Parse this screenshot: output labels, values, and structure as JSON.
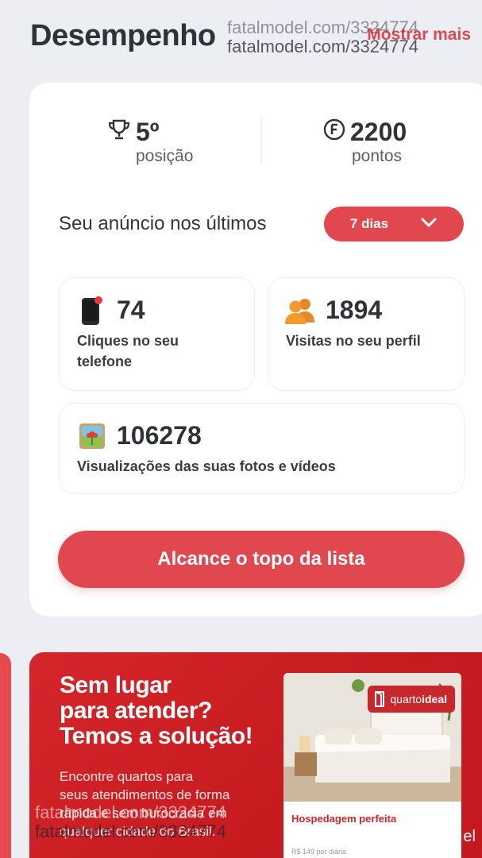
{
  "header": {
    "title": "Desempenho",
    "show_more": "Mostrar mais",
    "watermark": "fatalmodel.com/3324774"
  },
  "ranking": {
    "position_value": "5º",
    "position_label": "posição",
    "points_value": "2200",
    "points_label": "pontos",
    "trophy_icon": "trophy-icon",
    "points_icon": "points-coin-icon"
  },
  "period": {
    "label": "Seu anúncio nos últimos",
    "selected": "7 dias"
  },
  "stats": {
    "phone_clicks": {
      "value": "74",
      "label_line1": "Cliques no seu",
      "label_line2": "telefone",
      "icon": "phone-icon"
    },
    "profile_visits": {
      "value": "1894",
      "label": "Visitas no seu perfil",
      "icon": "people-icon"
    },
    "media_views": {
      "value": "106278",
      "label": "Visualizações das suas fotos e vídeos",
      "icon": "photo-icon"
    }
  },
  "cta": {
    "label": "Alcance o topo da lista"
  },
  "banner": {
    "headline_line1": "Sem lugar",
    "headline_line2": "para atender?",
    "headline_line3": "Temos a solução!",
    "text_line1": "Encontre quartos para",
    "text_line2": "seus atendimentos de forma",
    "text_line3": "rápida e sem burocracia em",
    "text_line4": "qualquer cidade do Brasil.",
    "ad_logo_prefix": "quarto",
    "ad_logo_suffix": "ideal",
    "ad_title": "Hospedagem perfeita",
    "ad_price": "R$ 149 por diária",
    "edge_text": "el"
  },
  "colors": {
    "accent": "#e1474f",
    "banner": "#cc1f24",
    "background": "#eceef3"
  }
}
